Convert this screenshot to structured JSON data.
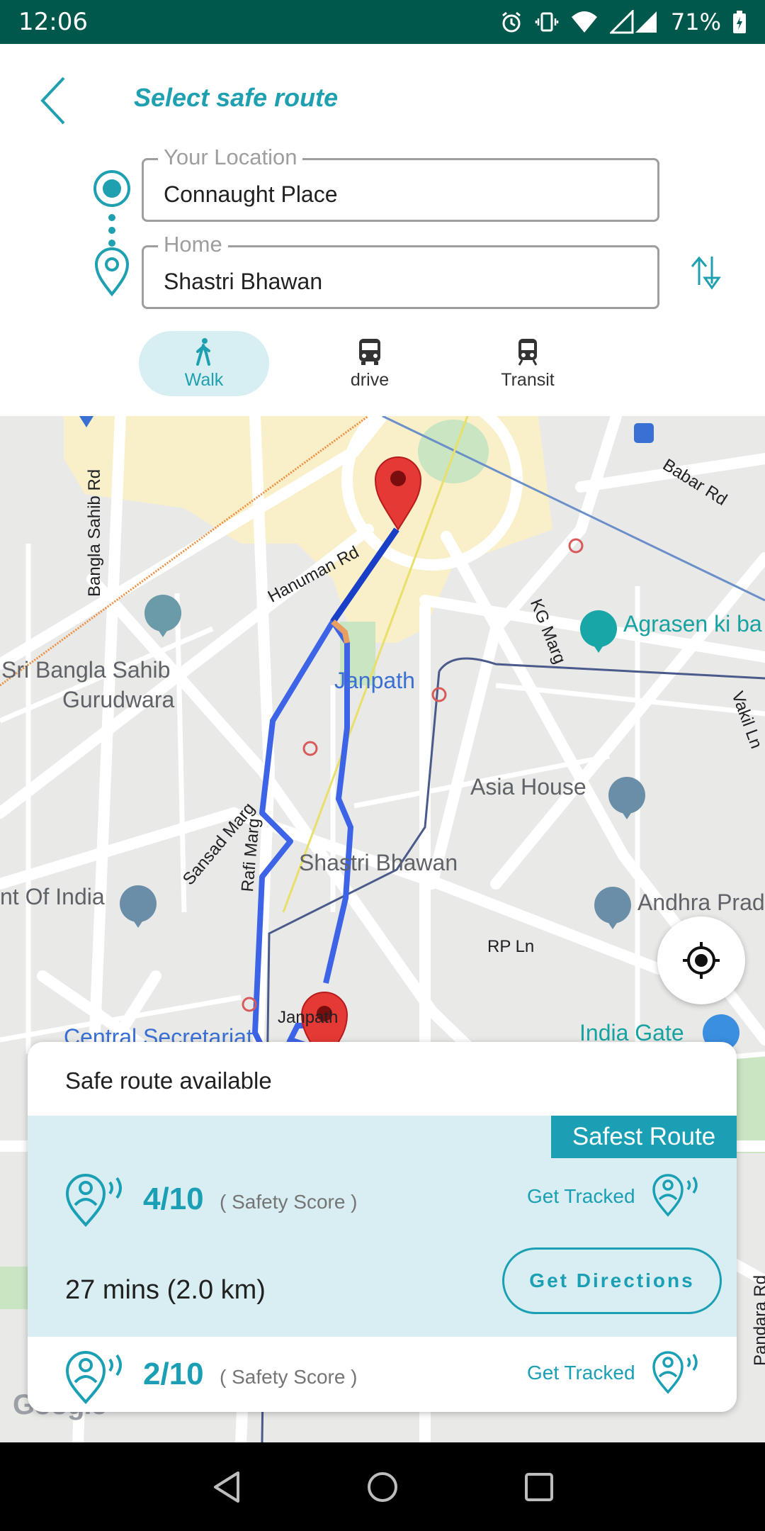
{
  "status_bar": {
    "time": "12:06",
    "battery": "71%",
    "icons": [
      "alarm-icon",
      "vibrate-icon",
      "wifi-icon",
      "signal-icon",
      "battery-icon"
    ]
  },
  "header": {
    "title": "Select safe route",
    "back_icon": "chevron-left-icon",
    "from": {
      "legend": "Your Location",
      "value": "Connaught Place"
    },
    "to": {
      "legend": "Home",
      "value": "Shastri Bhawan"
    },
    "swap_icon": "swap-vertical-icon"
  },
  "modes": [
    {
      "label": "Walk",
      "icon": "walk-icon",
      "active": true
    },
    {
      "label": "drive",
      "icon": "bus-icon",
      "active": false
    },
    {
      "label": "Transit",
      "icon": "train-icon",
      "active": false
    }
  ],
  "map": {
    "labels": {
      "babar_rd": "Babar Rd",
      "bangla_sahib_rd": "Bangla Sahib Rd",
      "hanuman_rd": "Hanuman Rd",
      "kg_marg": "KG Marg",
      "agrasen": "Agrasen ki ba",
      "sri_bangla_1": "Sri Bangla Sahib",
      "sri_bangla_2": "Gurudwara",
      "janpath": "Janpath",
      "vakil_ln": "Vakil Ln",
      "asia_house": "Asia House",
      "sansad_marg": "Sansad Marg",
      "rafi_marg": "Rafi Marg",
      "shastri_bhawan": "Shastri Bhawan",
      "of_india": "nt Of India",
      "andhra": "Andhra Prad",
      "rp_ln": "RP Ln",
      "janpath_south": "Janpath",
      "central_secretariat": "Central Secretariat",
      "india_gate": "India Gate",
      "pandara_rd": "Pandara Rd"
    },
    "accent_route_color": "#3d63e6",
    "pin_color": "#e53935"
  },
  "card": {
    "title": "Safe route available",
    "routes": [
      {
        "badge": "Safest Route",
        "score": "4/10",
        "score_label": "( Safety Score )",
        "track_label": "Get Tracked",
        "duration": "27 mins (2.0 km)",
        "directions_label": "Get Directions"
      },
      {
        "score": "2/10",
        "score_label": "( Safety Score )",
        "track_label": "Get Tracked"
      }
    ]
  },
  "map_attribution": "Google",
  "colors": {
    "accent": "#1a9fb4",
    "status_bar": "#00574b",
    "selected_mode_bg": "#d7eff3"
  }
}
